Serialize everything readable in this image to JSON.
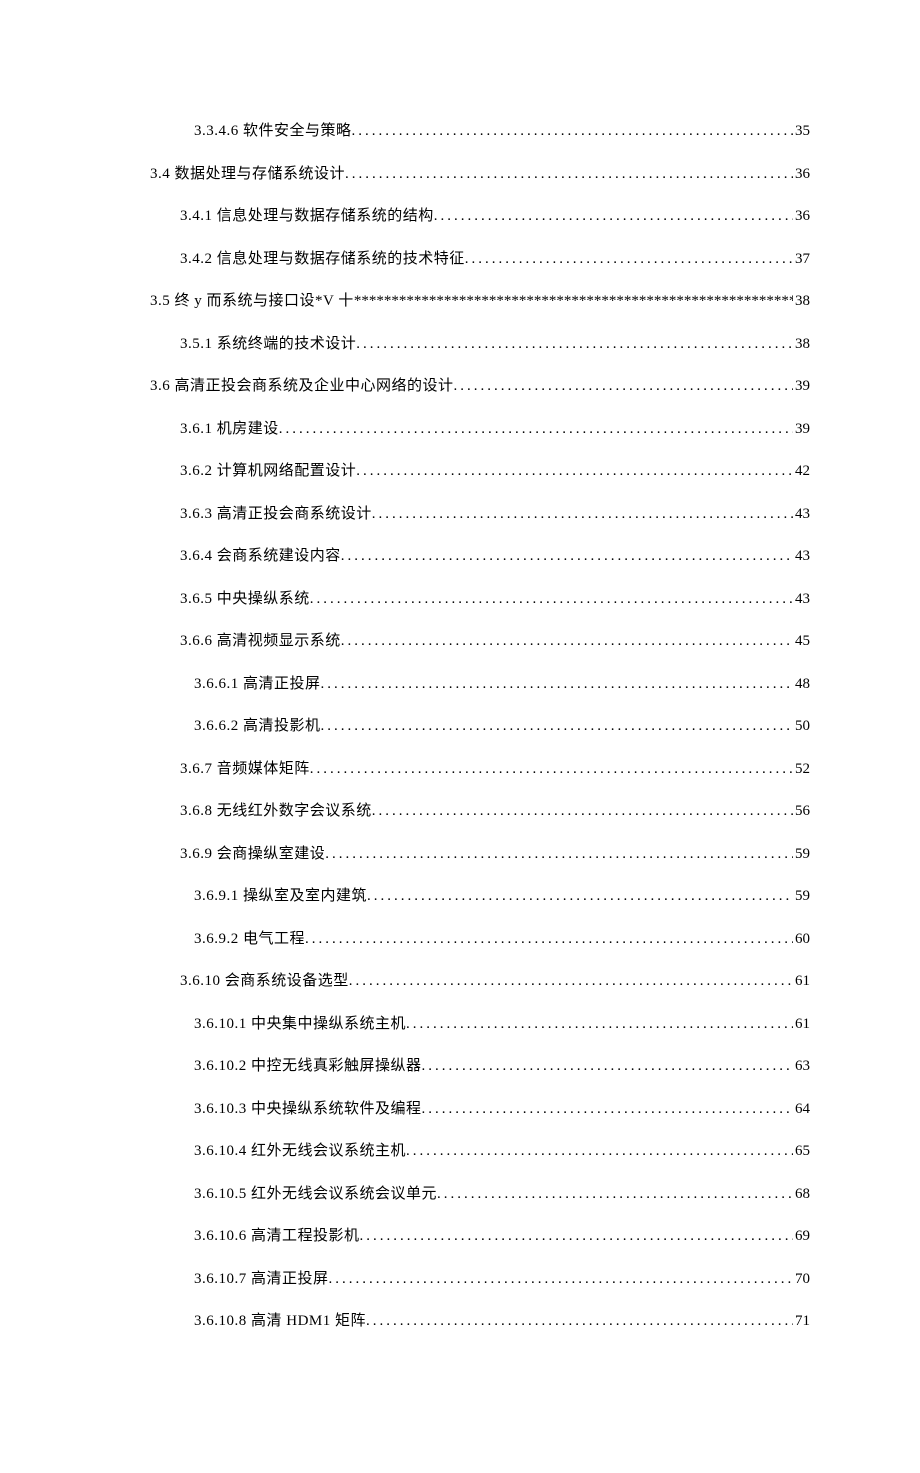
{
  "entries": [
    {
      "indent": 2,
      "label": "3.3.4.6 软件安全与策略",
      "page": "35",
      "style": "dot"
    },
    {
      "indent": 0,
      "label": "3.4 数据处理与存储系统设计",
      "page": "36",
      "style": "dot"
    },
    {
      "indent": 1,
      "label": "3.4.1 信息处理与数据存储系统的结构",
      "page": "36",
      "style": "dot"
    },
    {
      "indent": 1,
      "label": "3.4.2 信息处理与数据存储系统的技术特征",
      "page": "37",
      "style": "dot"
    },
    {
      "indent": 0,
      "label": "3.5 终 y 而系统与接口设*V 十",
      "page": "38",
      "style": "asterisk"
    },
    {
      "indent": 1,
      "label": "3.5.1 系统终端的技术设计",
      "page": "38",
      "style": "dot"
    },
    {
      "indent": 0,
      "label": "3.6 高清正投会商系统及企业中心网络的设计",
      "page": "39",
      "style": "dot"
    },
    {
      "indent": 1,
      "label": "3.6.1 机房建设",
      "page": "39",
      "style": "dot"
    },
    {
      "indent": 1,
      "label": "3.6.2 计算机网络配置设计",
      "page": "42",
      "style": "dot"
    },
    {
      "indent": 1,
      "label": "3.6.3 高清正投会商系统设计",
      "page": "43",
      "style": "dot"
    },
    {
      "indent": 1,
      "label": "3.6.4 会商系统建设内容",
      "page": "43",
      "style": "dot"
    },
    {
      "indent": 1,
      "label": "3.6.5 中央操纵系统",
      "page": "43",
      "style": "dot"
    },
    {
      "indent": 1,
      "label": "3.6.6 高清视频显示系统",
      "page": "45",
      "style": "dot"
    },
    {
      "indent": 2,
      "label": "3.6.6.1 高清正投屏",
      "page": "48",
      "style": "dot"
    },
    {
      "indent": 2,
      "label": "3.6.6.2 高清投影机",
      "page": "50",
      "style": "dot"
    },
    {
      "indent": 1,
      "label": "3.6.7 音频媒体矩阵",
      "page": "52",
      "style": "dot"
    },
    {
      "indent": 1,
      "label": "3.6.8 无线红外数字会议系统",
      "page": "56",
      "style": "dot"
    },
    {
      "indent": 1,
      "label": "3.6.9 会商操纵室建设",
      "page": "59",
      "style": "dot"
    },
    {
      "indent": 2,
      "label": "3.6.9.1 操纵室及室内建筑",
      "page": "59",
      "style": "dot"
    },
    {
      "indent": 2,
      "label": "3.6.9.2 电气工程",
      "page": "60",
      "style": "dot"
    },
    {
      "indent": 1,
      "label": "3.6.10 会商系统设备选型",
      "page": "61",
      "style": "dot"
    },
    {
      "indent": 3,
      "label": "3.6.10.1 中央集中操纵系统主机",
      "page": "61",
      "style": "dot"
    },
    {
      "indent": 3,
      "label": "3.6.10.2 中控无线真彩触屏操纵器",
      "page": "63",
      "style": "dot"
    },
    {
      "indent": 3,
      "label": "3.6.10.3 中央操纵系统软件及编程",
      "page": "64",
      "style": "dot"
    },
    {
      "indent": 3,
      "label": "3.6.10.4 红外无线会议系统主机",
      "page": "65",
      "style": "dot"
    },
    {
      "indent": 3,
      "label": "3.6.10.5 红外无线会议系统会议单元",
      "page": "68",
      "style": "dot"
    },
    {
      "indent": 3,
      "label": "3.6.10.6 高清工程投影机",
      "page": "69",
      "style": "dot"
    },
    {
      "indent": 3,
      "label": "3.6.10.7 高清正投屏",
      "page": "70",
      "style": "dot"
    },
    {
      "indent": 3,
      "label": "3.6.10.8 高清 HDM1 矩阵",
      "page": "71",
      "style": "dot"
    }
  ]
}
